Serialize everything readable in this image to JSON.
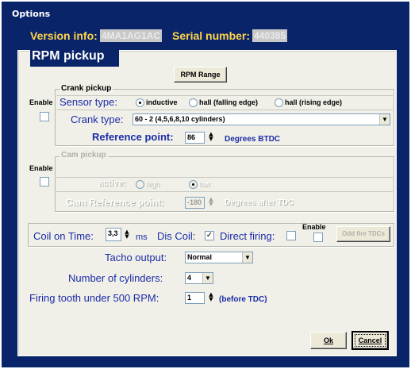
{
  "window": {
    "title": "Options"
  },
  "header": {
    "version_label": "Version info:",
    "version_value": "4MA1AG1AC",
    "serial_label": "Serial number:",
    "serial_value": "440385"
  },
  "section": {
    "title": "RPM pickup"
  },
  "rpm_range_button": "RPM Range",
  "crank": {
    "legend": "Crank pickup",
    "enable_label": "Enable",
    "sensor_type_label": "Sensor type:",
    "sensor_options": [
      "inductive",
      "hall (falling edge)",
      "hall (rising edge)"
    ],
    "sensor_selected": "inductive",
    "crank_type_label": "Crank type:",
    "crank_type_value": "60 - 2  (4,5,6,8,10 cylinders)",
    "ref_point_label": "Reference point:",
    "ref_point_value": "86",
    "ref_point_unit": "Degrees BTDC"
  },
  "cam": {
    "legend": "Cam pickup",
    "enable_label": "Enable",
    "active_label": "active:",
    "active_options": [
      "high",
      "low"
    ],
    "active_selected": "low",
    "ref_point_label": "Cam Reference point:",
    "ref_point_value": "-180",
    "ref_point_unit": "Degrees after TDC"
  },
  "coil": {
    "on_time_label": "Coil on Time:",
    "on_time_value": "3,3",
    "on_time_unit": "ms",
    "dis_coil_label": "Dis Coil:",
    "dis_coil_checked": true,
    "direct_firing_label": "Direct firing:",
    "enable_label": "Enable",
    "odd_fire_button": "Odd fire TDCs"
  },
  "tacho": {
    "label": "Tacho output:",
    "value": "Normal"
  },
  "cylinders": {
    "label": "Number of cylinders:",
    "value": "4"
  },
  "firing": {
    "label": "Firing tooth under 500 RPM:",
    "value": "1",
    "unit": "(before TDC)"
  },
  "buttons": {
    "ok": "Ok",
    "cancel": "Cancel"
  }
}
